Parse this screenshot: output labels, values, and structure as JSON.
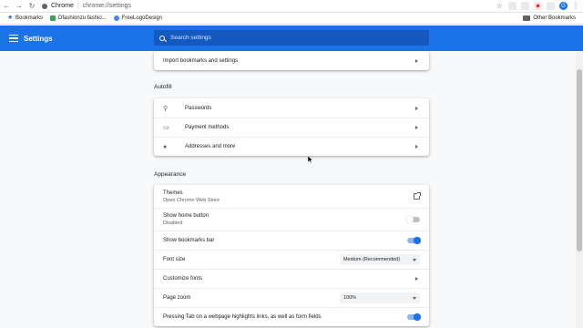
{
  "browser": {
    "site_name": "Chrome",
    "url": "chrome://settings",
    "avatar_letter": "G",
    "bookmarks": [
      {
        "label": "Bookmarks",
        "icon": "star-icon"
      },
      {
        "label": "Dfashionzu fashio...",
        "icon": "shop-icon"
      },
      {
        "label": "FreeLogoDesign",
        "icon": "logo-icon"
      }
    ],
    "other_bookmarks": "Other Bookmarks"
  },
  "header": {
    "title": "Settings",
    "search_placeholder": "Search settings",
    "accent_color": "#1a73e8"
  },
  "sections": {
    "import_row": "Import bookmarks and settings",
    "autofill": {
      "title": "Autofill",
      "items": [
        {
          "label": "Passwords",
          "icon": "key-icon"
        },
        {
          "label": "Payment methods",
          "icon": "credit-card-icon"
        },
        {
          "label": "Addresses and more",
          "icon": "location-pin-icon"
        }
      ]
    },
    "appearance": {
      "title": "Appearance",
      "themes_label": "Themes",
      "themes_sub": "Open Chrome Web Store",
      "home_button_label": "Show home button",
      "home_button_sub": "Disabled",
      "bookmarks_bar_label": "Show bookmarks bar",
      "font_size_label": "Font size",
      "font_size_value": "Medium (Recommended)",
      "customize_fonts_label": "Customize fonts",
      "page_zoom_label": "Page zoom",
      "page_zoom_value": "100%",
      "tab_highlight_label": "Pressing Tab on a webpage highlights links, as well as form fields"
    }
  }
}
